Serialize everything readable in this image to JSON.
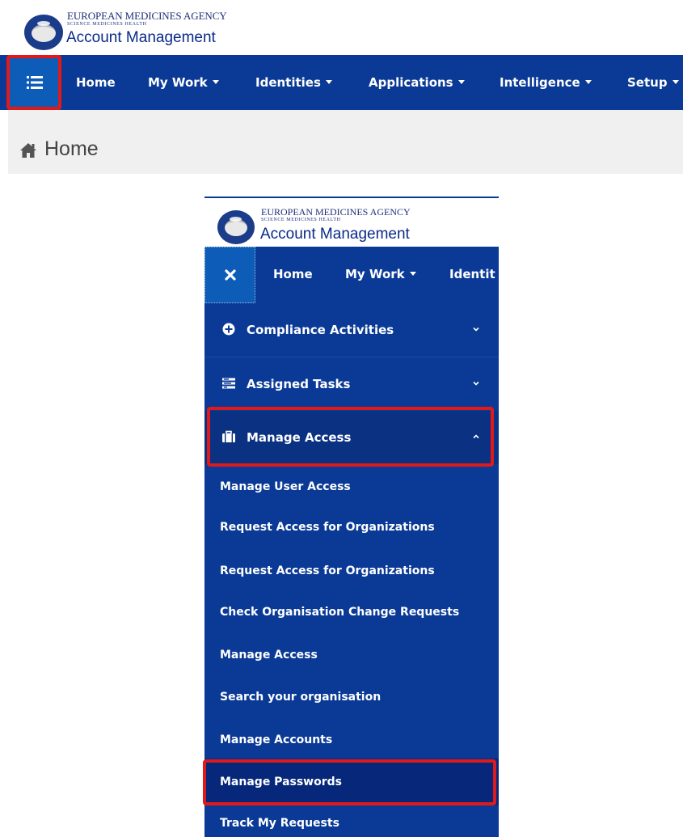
{
  "header": {
    "agency": "EUROPEAN MEDICINES AGENCY",
    "tagline": "SCIENCE  MEDICINES  HEALTH",
    "app_title": "Account Management"
  },
  "nav": {
    "items": [
      {
        "label": "Home"
      },
      {
        "label": "My Work"
      },
      {
        "label": "Identities"
      },
      {
        "label": "Applications"
      },
      {
        "label": "Intelligence"
      },
      {
        "label": "Setup"
      }
    ]
  },
  "breadcrumb": {
    "label": "Home"
  },
  "inset": {
    "nav": {
      "home": "Home",
      "my_work": "My Work",
      "identities_partial": "Identit"
    },
    "menu": [
      {
        "label": "Compliance Activities",
        "icon": "plus-circle-icon"
      },
      {
        "label": "Assigned Tasks",
        "icon": "tasks-icon"
      },
      {
        "label": "Manage Access",
        "icon": "briefcase-icon"
      }
    ],
    "submenu": [
      {
        "label": "Manage User Access"
      },
      {
        "label": "Request Access for Organizations"
      },
      {
        "label": "Request Access for Organizations"
      },
      {
        "label": "Check Organisation Change Requests"
      },
      {
        "label": "Manage Access"
      },
      {
        "label": "Search your organisation"
      },
      {
        "label": "Manage Accounts"
      },
      {
        "label": "Manage Passwords"
      },
      {
        "label": "Track My Requests"
      }
    ]
  },
  "colors": {
    "nav_bg": "#0a3a96",
    "active_btn": "#0d5cb8",
    "highlight": "#e01a1a"
  }
}
